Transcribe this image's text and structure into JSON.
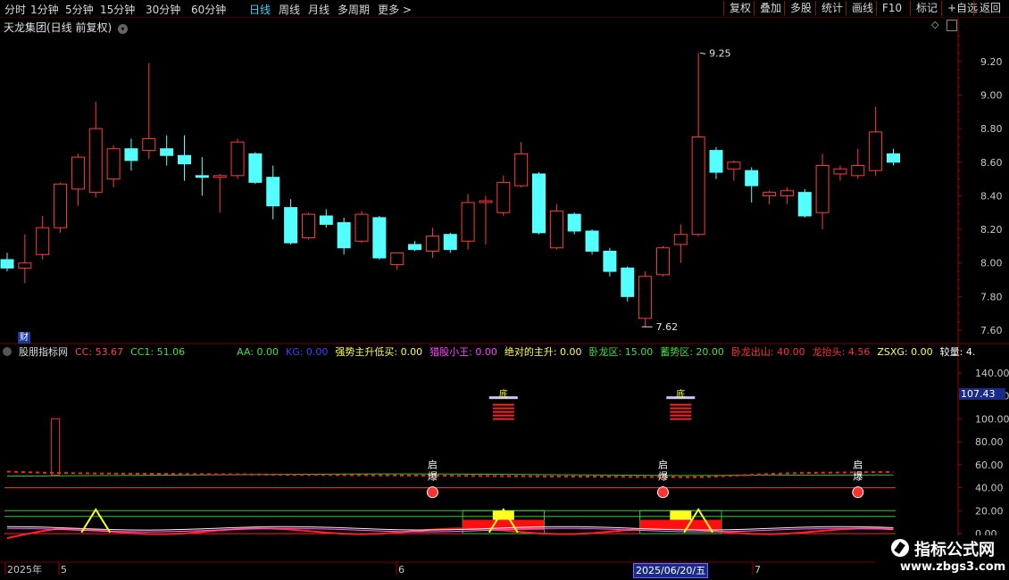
{
  "toolbar": {
    "periods": [
      "分时",
      "1分钟",
      "5分钟",
      "15分钟",
      "30分钟",
      "60分钟",
      "日线",
      "周线",
      "月线",
      "多周期",
      "更多 >"
    ],
    "active_period": "日线",
    "right_buttons": [
      "复权",
      "叠加",
      "多股",
      "统计",
      "画线",
      "F10",
      "标记",
      "+自选",
      "返回"
    ]
  },
  "stock": {
    "title": "天龙集团(日线 前复权)",
    "high_label": "9.25",
    "low_label": "7.62",
    "fin_badge": "财"
  },
  "price_axis": [
    "9.20",
    "9.00",
    "8.80",
    "8.60",
    "8.40",
    "8.20",
    "8.00",
    "7.80",
    "7.60"
  ],
  "indicator": {
    "name": "股朋指标网",
    "items": [
      {
        "text": "CC: 53.67",
        "color": "#ff4040"
      },
      {
        "text": "CC1: 51.06",
        "color": "#40e040"
      },
      {
        "text": "AA: 0.00",
        "color": "#40e040"
      },
      {
        "text": "KG: 0.00",
        "color": "#4040ff"
      },
      {
        "text": "强势主升低买: 0.00",
        "color": "#ffff40"
      },
      {
        "text": "猎股小王: 0.00",
        "color": "#ff40ff"
      },
      {
        "text": "绝对的主升: 0.00",
        "color": "#ffff40"
      },
      {
        "text": "卧龙区: 15.00",
        "color": "#40e040"
      },
      {
        "text": "蓄势区: 20.00",
        "color": "#40e040"
      },
      {
        "text": "卧龙出山: 40.00",
        "color": "#ff3030"
      },
      {
        "text": "龙抬头: 4.56",
        "color": "#ff3030"
      },
      {
        "text": "ZSXG: 0.00",
        "color": "#ffff40"
      },
      {
        "text": "较量: 4.",
        "color": "#ffffff"
      }
    ],
    "axis": [
      "140.00",
      "120.00",
      "100.00",
      "80.00",
      "60.00",
      "40.00",
      "20.00",
      "0.00"
    ],
    "current_value": "107.43",
    "signal_bottom": "底",
    "signal_qibao": [
      "启",
      "爆"
    ]
  },
  "date_axis": {
    "labels": [
      "2025年",
      "5",
      "6",
      "7"
    ],
    "cursor_date": "2025/06/20/五"
  },
  "watermark": {
    "title": "指标公式网",
    "url": "www.zbgs3.com"
  },
  "colors": {
    "up": "#ff3b3b",
    "down": "#54ffff",
    "grid": "#7a0000",
    "active": "#3ad0ff"
  },
  "chart_data": {
    "type": "candlestick",
    "ohlc": [
      [
        8.02,
        8.06,
        7.95,
        7.97
      ],
      [
        7.97,
        8.17,
        7.88,
        8.0
      ],
      [
        8.05,
        8.28,
        8.02,
        8.21
      ],
      [
        8.21,
        8.48,
        8.18,
        8.47
      ],
      [
        8.44,
        8.65,
        8.34,
        8.63
      ],
      [
        8.42,
        8.96,
        8.39,
        8.8
      ],
      [
        8.5,
        8.7,
        8.45,
        8.68
      ],
      [
        8.68,
        8.74,
        8.55,
        8.61
      ],
      [
        8.67,
        9.19,
        8.62,
        8.74
      ],
      [
        8.68,
        8.76,
        8.58,
        8.64
      ],
      [
        8.64,
        8.76,
        8.49,
        8.59
      ],
      [
        8.52,
        8.63,
        8.4,
        8.51
      ],
      [
        8.51,
        8.53,
        8.3,
        8.52
      ],
      [
        8.52,
        8.74,
        8.5,
        8.72
      ],
      [
        8.65,
        8.66,
        8.47,
        8.48
      ],
      [
        8.51,
        8.58,
        8.26,
        8.34
      ],
      [
        8.33,
        8.38,
        8.11,
        8.12
      ],
      [
        8.15,
        8.3,
        8.14,
        8.29
      ],
      [
        8.28,
        8.32,
        8.21,
        8.23
      ],
      [
        8.24,
        8.27,
        8.05,
        8.09
      ],
      [
        8.13,
        8.31,
        8.12,
        8.29
      ],
      [
        8.27,
        8.28,
        8.02,
        8.03
      ],
      [
        7.99,
        8.05,
        7.96,
        8.06
      ],
      [
        8.11,
        8.13,
        8.07,
        8.08
      ],
      [
        8.07,
        8.21,
        8.03,
        8.16
      ],
      [
        8.17,
        8.18,
        8.06,
        8.08
      ],
      [
        8.13,
        8.41,
        8.08,
        8.36
      ],
      [
        8.36,
        8.4,
        8.11,
        8.37
      ],
      [
        8.3,
        8.52,
        8.28,
        8.48
      ],
      [
        8.46,
        8.72,
        8.45,
        8.65
      ],
      [
        8.53,
        8.54,
        8.17,
        8.18
      ],
      [
        8.09,
        8.35,
        8.08,
        8.31
      ],
      [
        8.29,
        8.3,
        8.17,
        8.19
      ],
      [
        8.19,
        8.2,
        8.05,
        8.07
      ],
      [
        8.07,
        8.09,
        7.92,
        7.95
      ],
      [
        7.97,
        7.98,
        7.77,
        7.8
      ],
      [
        7.67,
        7.95,
        7.62,
        7.92
      ],
      [
        7.93,
        8.1,
        7.92,
        8.09
      ],
      [
        8.11,
        8.23,
        8.0,
        8.17
      ],
      [
        8.17,
        9.25,
        8.16,
        8.75
      ],
      [
        8.67,
        8.69,
        8.5,
        8.54
      ],
      [
        8.56,
        8.61,
        8.49,
        8.6
      ],
      [
        8.55,
        8.57,
        8.36,
        8.46
      ],
      [
        8.4,
        8.43,
        8.35,
        8.42
      ],
      [
        8.4,
        8.45,
        8.35,
        8.43
      ],
      [
        8.42,
        8.44,
        8.27,
        8.28
      ],
      [
        8.3,
        8.65,
        8.2,
        8.58
      ],
      [
        8.53,
        8.58,
        8.49,
        8.56
      ],
      [
        8.52,
        8.68,
        8.5,
        8.58
      ],
      [
        8.55,
        8.93,
        8.52,
        8.78
      ],
      [
        8.65,
        8.68,
        8.58,
        8.6
      ]
    ],
    "ylim": [
      7.6,
      9.3
    ],
    "cc": [
      54,
      53.5,
      53,
      52.8,
      52.6,
      52.4,
      52.3,
      52.2,
      52.1,
      52.0,
      51.9,
      51.8,
      51.7,
      51.6,
      51.5,
      51.4,
      51.3,
      51.2,
      51.1,
      51.0,
      50.9,
      50.8,
      50.7,
      50.6,
      50.5,
      50.4,
      50.3,
      50.2,
      50.1,
      50.0,
      49.9,
      49.8,
      49.8,
      49.7,
      49.6,
      49.5,
      49.4,
      49.3,
      49.2,
      49.1,
      49.8,
      50.5,
      51.2,
      51.9,
      52.5,
      52.8,
      53.0,
      53.2,
      53.4,
      53.6,
      53.67
    ],
    "cc1": [
      50,
      50.1,
      50.2,
      50.3,
      50.4,
      50.5,
      50.6,
      50.7,
      50.8,
      50.9,
      51.0,
      51.1,
      51.2,
      51.3,
      51.4,
      51.5,
      51.6,
      51.7,
      51.8,
      51.9,
      52.0,
      52.0,
      52.0,
      52.0,
      52.0,
      51.9,
      51.8,
      51.7,
      51.6,
      51.5,
      51.4,
      51.3,
      51.2,
      51.1,
      51.0,
      50.9,
      50.8,
      50.7,
      50.6,
      50.6,
      50.7,
      50.8,
      50.9,
      51.0,
      51.0,
      51.0,
      51.0,
      51.0,
      51.05,
      51.06,
      51.06
    ],
    "spike_index": 3,
    "spike_value": 100,
    "bottom_signal_indices": [
      28,
      38
    ],
    "qibao_indices": [
      24,
      37,
      48
    ],
    "yellow_triangle_indices": [
      5,
      28,
      39
    ],
    "zone_ranges": [
      [
        26,
        30
      ],
      [
        36,
        40
      ]
    ],
    "ylim_indicator": [
      0,
      150
    ]
  }
}
